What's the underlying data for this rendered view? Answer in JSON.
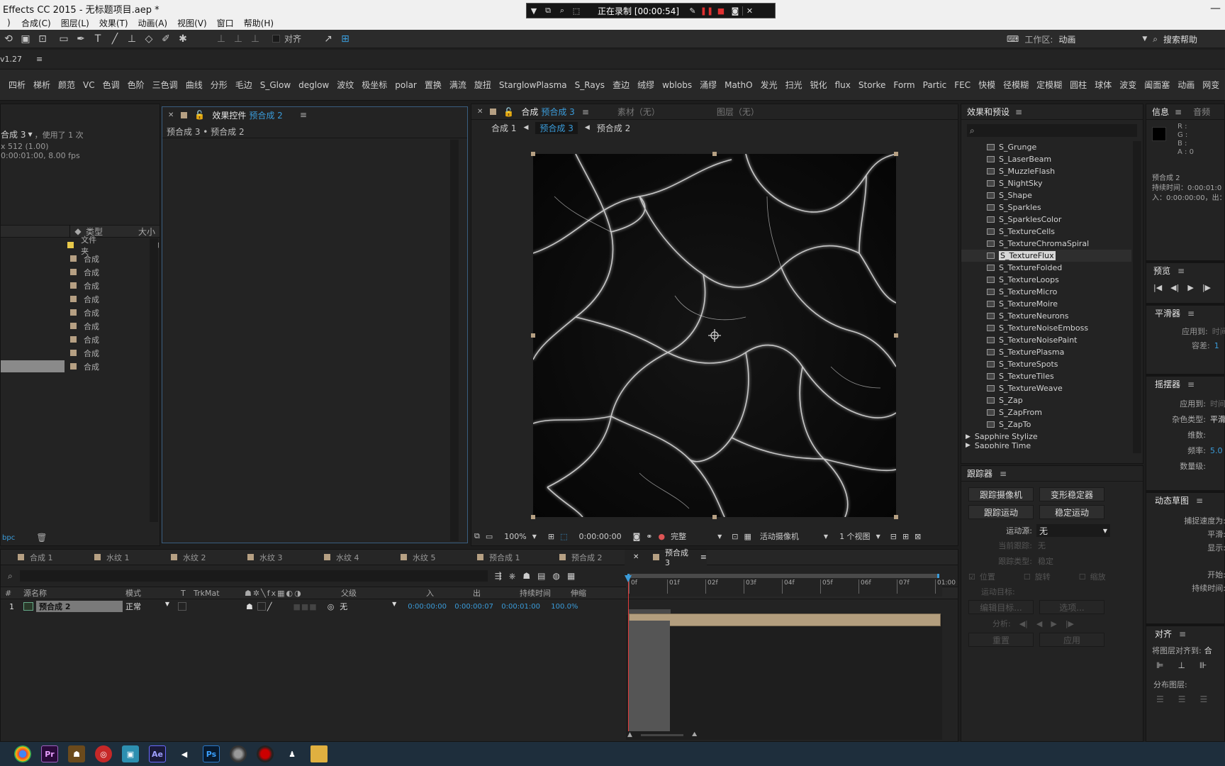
{
  "app": {
    "title": "Effects CC 2015 - 无标题项目.aep *",
    "menu": [
      "合成(C)",
      "图层(L)",
      "效果(T)",
      "动画(A)",
      "视图(V)",
      "窗口",
      "帮助(H)"
    ],
    "version": "v1.27"
  },
  "recording": {
    "status": "正在录制 [00:00:54]"
  },
  "toolbar": {
    "align_label": "对齐",
    "workspace_label": "工作区:",
    "workspace_value": "动画",
    "search_help": "搜索帮助"
  },
  "fx_buttons": [
    "四析",
    "梯析",
    "颜范",
    "VC",
    "色调",
    "色阶",
    "三色调",
    "曲线",
    "分形",
    "毛边",
    "S_Glow",
    "deglow",
    "波纹",
    "极坐标",
    "polar",
    "置换",
    "满流",
    "旋扭",
    "StarglowPlasma",
    "S_Rays",
    "查边",
    "绒缪",
    "wblobs",
    "涌缪",
    "MathO",
    "发光",
    "扫光",
    "锐化",
    "flux",
    "Storke",
    "Form",
    "Partic",
    "FEC",
    "快模",
    "径模糊",
    "定模糊",
    "圆柱",
    "球体",
    "波变",
    "阖面塞",
    "动画",
    "网变"
  ],
  "project": {
    "selected_name": "合成 3",
    "usage": "，使用了 1 次",
    "dims": "x 512 (1.00)",
    "duration": "0:00:01:00, 8.00 fps",
    "col_type": "类型",
    "col_size": "大小",
    "rows": [
      "文件夹",
      "合成",
      "合成",
      "合成",
      "合成",
      "合成",
      "合成",
      "合成",
      "合成",
      "合成"
    ],
    "footer": "bpc"
  },
  "effect_controls": {
    "tab": "效果控件",
    "target": "预合成 2",
    "breadcrumb": "预合成 3 • 预合成 2"
  },
  "composition": {
    "tab_label": "合成",
    "tab_target": "预合成 3",
    "material_tab": "素材（无）",
    "layer_tab": "图层（无）",
    "nav": [
      "合成 1",
      "预合成 3",
      "预合成 2"
    ],
    "zoom": "100%",
    "timecode": "0:00:00:00",
    "quality": "完整",
    "camera": "活动摄像机",
    "views": "1 个视图"
  },
  "effects_presets": {
    "title": "效果和预设",
    "items": [
      "S_Grunge",
      "S_LaserBeam",
      "S_MuzzleFlash",
      "S_NightSky",
      "S_Shape",
      "S_Sparkles",
      "S_SparklesColor",
      "S_TextureCells",
      "S_TextureChromaSpiral",
      "S_TextureFlux",
      "S_TextureFolded",
      "S_TextureLoops",
      "S_TextureMicro",
      "S_TextureMoire",
      "S_TextureNeurons",
      "S_TextureNoiseEmboss",
      "S_TextureNoisePaint",
      "S_TexturePlasma",
      "S_TextureSpots",
      "S_TextureTiles",
      "S_TextureWeave",
      "S_Zap",
      "S_ZapFrom",
      "S_ZapTo"
    ],
    "selected_index": 9,
    "group": "Sapphire Stylize",
    "group_next": "Sapphire Time"
  },
  "tracker": {
    "title": "跟踪器",
    "btn_camera": "跟踪摄像机",
    "btn_warp": "变形稳定器",
    "btn_track": "跟踪运动",
    "btn_stabilize": "稳定运动",
    "source_label": "运动源:",
    "source_value": "无",
    "current_label": "当前跟踪:",
    "current_value": "无",
    "type_label": "跟踪类型:",
    "type_value": "稳定",
    "pos": "位置",
    "rot": "旋转",
    "scale": "缩放",
    "target_label": "运动目标:",
    "edit_target": "编辑目标...",
    "options": "选项...",
    "analyze": "分析:",
    "reset": "重置",
    "apply": "应用"
  },
  "info": {
    "title": "信息",
    "audio_tab": "音频",
    "r": "R :",
    "g": "G :",
    "b": "B :",
    "a": "A : 0",
    "name": "预合成 2",
    "duration": "持续时间：0:00:01:0",
    "inout": "入：0:00:00:00，出：",
    "preview": "预览",
    "smoother": "平滑器",
    "apply_to": "应用到:",
    "apply_to_value": "时间图",
    "tolerance": "容差:",
    "tolerance_value": "1",
    "wiggler": "摇摆器",
    "wiggle_apply": "应用到:",
    "wiggle_apply_value": "时间图",
    "noise_type": "杂色类型:",
    "noise_value": "平滑",
    "dims": "维数:",
    "freq": "频率:",
    "freq_value": "5.0",
    "magnitude": "数量级:",
    "motion_sketch": "动态草图",
    "capture_speed": "捕捉速度为:",
    "smoothing": "平滑:",
    "display": "显示:",
    "start": "开始:",
    "duration2": "持续时间:",
    "align": "对齐",
    "align_to": "将图层对齐到:",
    "align_to_value": "合",
    "distribute": "分布图层:"
  },
  "timeline": {
    "tabs": [
      "合成 1",
      "水纹 1",
      "水纹 2",
      "水纹 3",
      "水纹 4",
      "水纹 5",
      "预合成 1",
      "预合成 2",
      "预合成 3"
    ],
    "active_tab": "预合成 3",
    "cols": {
      "source": "源名称",
      "mode": "模式",
      "t": "T",
      "trkmat": "TrkMat",
      "parent": "父级",
      "in": "入",
      "out": "出",
      "duration": "持续时间",
      "stretch": "伸缩"
    },
    "layer": {
      "index": "1",
      "name": "预合成 2",
      "mode": "正常",
      "parent": "无",
      "in": "0:00:00:00",
      "out": "0:00:00:07",
      "duration": "0:00:01:00",
      "stretch": "100.0%"
    },
    "ruler": [
      "0f",
      "01f",
      "02f",
      "03f",
      "04f",
      "05f",
      "06f",
      "07f",
      "01:00"
    ]
  },
  "taskbar": {
    "apps": [
      "chrome",
      "premiere",
      "app-a",
      "app-b",
      "app-c",
      "after-effects",
      "media",
      "photoshop",
      "app-d",
      "app-e",
      "qq",
      "folder"
    ]
  }
}
